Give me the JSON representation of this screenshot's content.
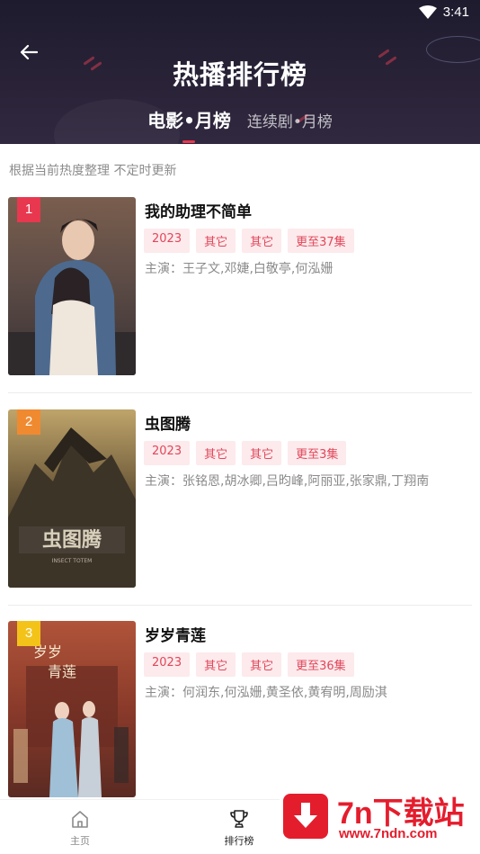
{
  "status_bar": {
    "time": "3:41"
  },
  "header": {
    "title": "热播排行榜",
    "tabs": [
      {
        "label": "电影•月榜",
        "active": true
      },
      {
        "label": "连续剧•月榜",
        "active": false
      }
    ]
  },
  "subtitle": "根据当前热度整理 不定时更新",
  "items": [
    {
      "rank": "1",
      "rank_color": "#e8384f",
      "title": "我的助理不简单",
      "tags": [
        "2023",
        "其它",
        "其它",
        "更至37集"
      ],
      "cast": "主演：王子文,邓婕,白敬亭,何泓姗"
    },
    {
      "rank": "2",
      "rank_color": "#f08a30",
      "title": "虫图腾",
      "tags": [
        "2023",
        "其它",
        "其它",
        "更至3集"
      ],
      "cast": "主演：张铭恩,胡冰卿,吕昀峰,阿丽亚,张家鼎,丁翔南"
    },
    {
      "rank": "3",
      "rank_color": "#f3c31a",
      "title": "岁岁青莲",
      "tags": [
        "2023",
        "其它",
        "其它",
        "更至36集"
      ],
      "cast": "主演：何润东,何泓姗,黄圣依,黄宥明,周励淇"
    }
  ],
  "bottom_nav": [
    {
      "label": "主页",
      "icon": "home-icon",
      "active": false
    },
    {
      "label": "排行榜",
      "icon": "trophy-icon",
      "active": true
    }
  ],
  "watermark": {
    "brand": "7n下载站",
    "url": "www.7ndn.com"
  },
  "colors": {
    "accent": "#e8384f",
    "tag_bg": "#fdeaec",
    "tag_text": "#e0475a",
    "header_bg": "#231f31"
  }
}
